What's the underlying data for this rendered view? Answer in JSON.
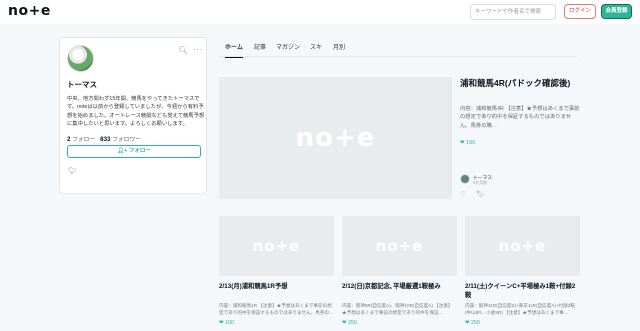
{
  "header": {
    "logo": "no+e",
    "search_placeholder": "キーワードや作者名で検索",
    "login_label": "ログイン",
    "signup_label": "会員登録"
  },
  "profile": {
    "name": "トーマス",
    "bio": "中央、地方問わず15年間、競馬をやってきたトーマスです。noteは以前から登録していましたが、今週から有料予想を始めました。オートレース競艇なども覚えて競馬予想に集中したいと思います。よろしくお願いします。",
    "following_count": "2",
    "following_label": "フォロー",
    "followers_count": "833",
    "followers_label": "フォロワー",
    "follow_button": "フォロー",
    "search_icon": "search-icon",
    "more_icon": "more-icon"
  },
  "tabs": [
    "ホーム",
    "記事",
    "マガジン",
    "スキ",
    "月別"
  ],
  "featured": {
    "thumb_text": "no+e",
    "title": "浦和競馬4R(パドック確認後)",
    "description": "内容：浦和競馬4R 【注意】★予想はあくまで事前の想定であり的中を保証するものではありません。馬券の購…",
    "likes": "100",
    "author": "トーマス",
    "time": "9か月前"
  },
  "cards": [
    {
      "thumb_text": "no+e",
      "title": "2/13(月)浦和競馬1R予想",
      "description": "内容：浦和競馬1R 【注意】★予想はあくまで事前の想定であり的中を保証するものではありません。馬券の…",
      "likes": "100"
    },
    {
      "thumb_text": "no+e",
      "title": "2/12(日)京都記念､平場厳選1鞍極み",
      "description": "内容：阪神9R(自信度A)、阪神10R(自信度A) 【注意】★予想はあくまで事前の想定であり的中を保証…",
      "likes": "250"
    },
    {
      "thumb_text": "no+e",
      "title": "2/11(土)クイーンC+平場極み1鞍+付録2鞍",
      "description": "内容：阪神11R(自信度S)+東京11R(自信度A)+付録2鞍(中山9R、小倉8R) 【注意】★予想はあくまで事…",
      "likes": "250"
    }
  ],
  "colors": {
    "accent": "#2cb696",
    "login_border": "#e07a7a"
  }
}
